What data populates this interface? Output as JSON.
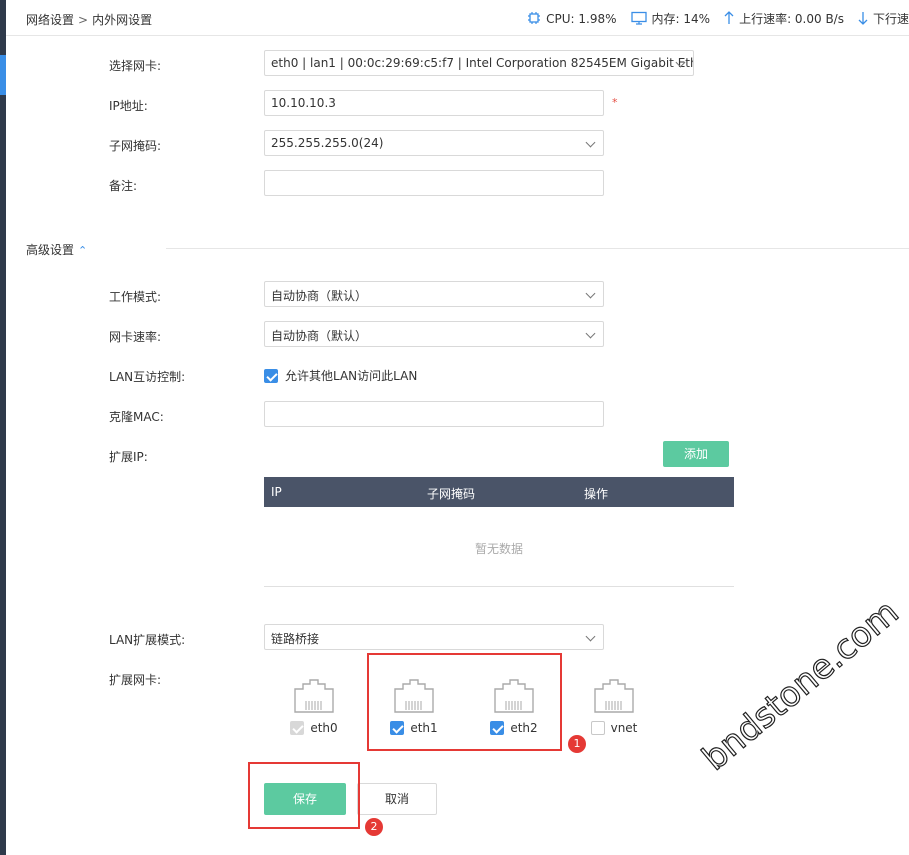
{
  "breadcrumb": {
    "parent": "网络设置",
    "separator": ">",
    "current": "内外网设置"
  },
  "stats": {
    "cpu": "CPU: 1.98%",
    "mem": "内存: 14%",
    "upload": "上行速率: 0.00 B/s",
    "download": "下行速"
  },
  "form": {
    "nic": {
      "label": "选择网卡:",
      "value": "eth0 | lan1 | 00:0c:29:69:c5:f7 | Intel Corporation 82545EM Gigabit Ethe"
    },
    "ip": {
      "label": "IP地址:",
      "value": "10.10.10.3",
      "required_mark": "*"
    },
    "mask": {
      "label": "子网掩码:",
      "value": "255.255.255.0(24)"
    },
    "note": {
      "label": "备注:",
      "value": ""
    }
  },
  "advanced": {
    "title": "高级设置",
    "work_mode": {
      "label": "工作模式:",
      "value": "自动协商（默认）"
    },
    "nic_speed": {
      "label": "网卡速率:",
      "value": "自动协商（默认）"
    },
    "lan_access": {
      "label": "LAN互访控制:",
      "checkbox_label": "允许其他LAN访问此LAN",
      "checked": true
    },
    "clone_mac": {
      "label": "克隆MAC:",
      "value": ""
    },
    "ext_ip": {
      "label": "扩展IP:",
      "add_button": "添加",
      "columns": [
        "IP",
        "子网掩码",
        "操作"
      ],
      "empty_text": "暂无数据"
    },
    "lan_ext_mode": {
      "label": "LAN扩展模式:",
      "value": "链路桥接"
    },
    "ext_nic": {
      "label": "扩展网卡:",
      "items": [
        {
          "name": "eth0",
          "checked": true,
          "disabled": true
        },
        {
          "name": "eth1",
          "checked": true,
          "disabled": false
        },
        {
          "name": "eth2",
          "checked": true,
          "disabled": false
        },
        {
          "name": "vnet",
          "checked": false,
          "disabled": false
        }
      ]
    }
  },
  "buttons": {
    "save": "保存",
    "cancel": "取消"
  },
  "annotations": {
    "badge1": "1",
    "badge2": "2"
  },
  "watermark": "bndstone.com",
  "colors": {
    "accent": "#3a8ee6",
    "green_button": "#5ccaa0",
    "table_header": "#4a5468",
    "annotation_red": "#e53935"
  }
}
